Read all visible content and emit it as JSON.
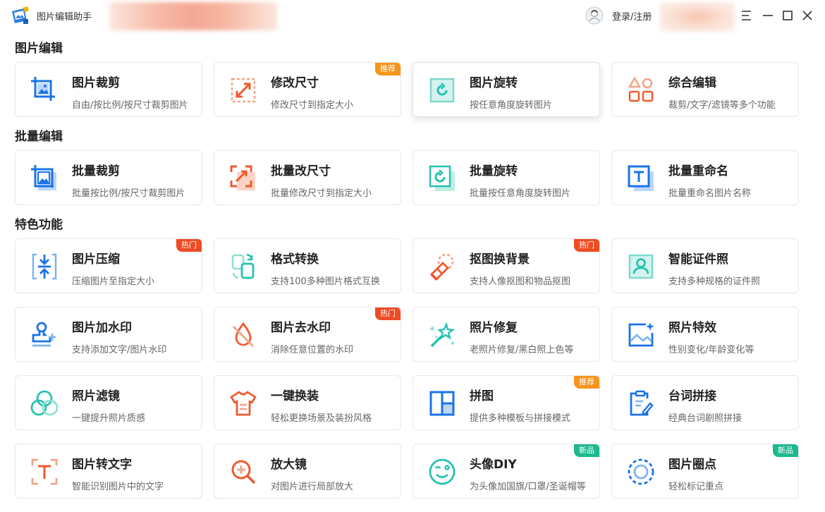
{
  "window": {
    "title": "图片编辑助手",
    "login": "登录/注册"
  },
  "colors": {
    "blue": "#1a73e8",
    "orange": "#ef5a2f",
    "teal": "#25c2b1",
    "badge_recommend": "#f7941d",
    "badge_hot": "#ef4b24",
    "badge_new": "#1db88e"
  },
  "sections": [
    {
      "title": "图片编辑",
      "cards": [
        {
          "title": "图片裁剪",
          "sub": "自由/按比例/按尺寸裁剪图片",
          "icon": "crop-icon"
        },
        {
          "title": "修改尺寸",
          "sub": "修改尺寸到指定大小",
          "icon": "resize-icon",
          "badge": "推荐"
        },
        {
          "title": "图片旋转",
          "sub": "按任意角度旋转图片",
          "icon": "rotate-icon"
        },
        {
          "title": "综合编辑",
          "sub": "裁剪/文字/滤镜等多个功能",
          "icon": "shapes-icon"
        }
      ]
    },
    {
      "title": "批量编辑",
      "cards": [
        {
          "title": "批量裁剪",
          "sub": "批量按比例/按尺寸裁剪图片",
          "icon": "batch-crop-icon"
        },
        {
          "title": "批量改尺寸",
          "sub": "批量修改尺寸到指定大小",
          "icon": "batch-resize-icon"
        },
        {
          "title": "批量旋转",
          "sub": "批量按任意角度旋转图片",
          "icon": "batch-rotate-icon"
        },
        {
          "title": "批量重命名",
          "sub": "批量重命名图片名称",
          "icon": "rename-icon"
        }
      ]
    },
    {
      "title": "特色功能",
      "cards": [
        {
          "title": "图片压缩",
          "sub": "压缩图片至指定大小",
          "icon": "compress-icon",
          "badge": "热门"
        },
        {
          "title": "格式转换",
          "sub": "支持100多种图片格式互换",
          "icon": "convert-icon"
        },
        {
          "title": "抠图换背景",
          "sub": "支持人像抠图和物品抠图",
          "icon": "cutout-icon",
          "badge": "热门"
        },
        {
          "title": "智能证件照",
          "sub": "支持多种规格的证件照",
          "icon": "id-photo-icon"
        },
        {
          "title": "图片加水印",
          "sub": "支持添加文字/图片水印",
          "icon": "stamp-icon"
        },
        {
          "title": "图片去水印",
          "sub": "消除任意位置的水印",
          "icon": "no-drop-icon",
          "badge": "热门"
        },
        {
          "title": "照片修复",
          "sub": "老照片修复/黑白照上色等",
          "icon": "magic-wand-icon"
        },
        {
          "title": "照片特效",
          "sub": "性别变化/年龄变化等",
          "icon": "effect-icon"
        },
        {
          "title": "照片滤镜",
          "sub": "一键提升照片质感",
          "icon": "filter-icon"
        },
        {
          "title": "一键换装",
          "sub": "轻松更换场景及装扮风格",
          "icon": "shirt-icon"
        },
        {
          "title": "拼图",
          "sub": "提供多种模板与拼接模式",
          "icon": "collage-icon",
          "badge": "推荐"
        },
        {
          "title": "台词拼接",
          "sub": "经典台词剧照拼接",
          "icon": "clipboard-icon"
        },
        {
          "title": "图片转文字",
          "sub": "智能识别图片中的文字",
          "icon": "ocr-icon"
        },
        {
          "title": "放大镜",
          "sub": "对图片进行局部放大",
          "icon": "magnifier-icon"
        },
        {
          "title": "头像DIY",
          "sub": "为头像加国旗/口罩/圣诞帽等",
          "icon": "smiley-icon",
          "badge": "新品"
        },
        {
          "title": "图片圈点",
          "sub": "轻松标记重点",
          "icon": "circle-mark-icon",
          "badge": "新品"
        }
      ]
    }
  ]
}
